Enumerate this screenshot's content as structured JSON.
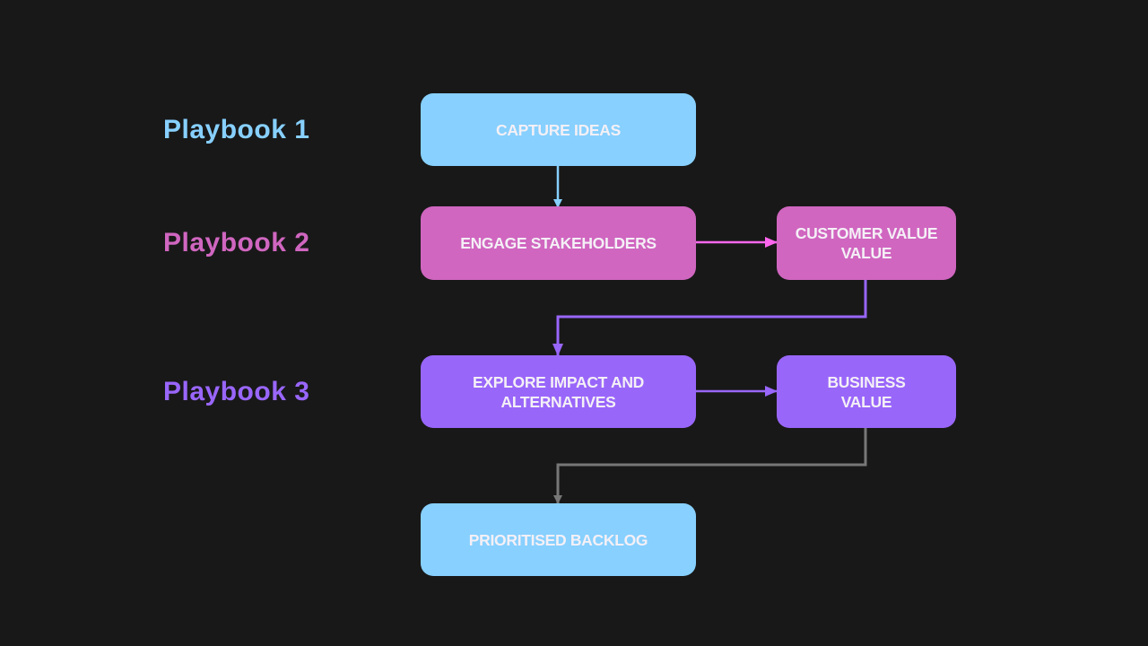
{
  "playbooks": [
    {
      "label": "Playbook 1",
      "color": "#87d0ff"
    },
    {
      "label": "Playbook 2",
      "color": "#d066c0"
    },
    {
      "label": "Playbook 3",
      "color": "#9966fa"
    }
  ],
  "nodes": {
    "capture": "CAPTURE IDEAS",
    "engage": "ENGAGE STAKEHOLDERS",
    "customer": "CUSTOMER VALUE VALUE",
    "explore": "EXPLORE IMPACT AND ALTERNATIVES",
    "business": "BUSINESS VALUE",
    "backlog": "PRIORITISED BACKLOG"
  },
  "edge_colors": {
    "blue": "#87d0ff",
    "pink": "#ff66ee",
    "purple": "#9966fa",
    "gray": "#777777"
  }
}
